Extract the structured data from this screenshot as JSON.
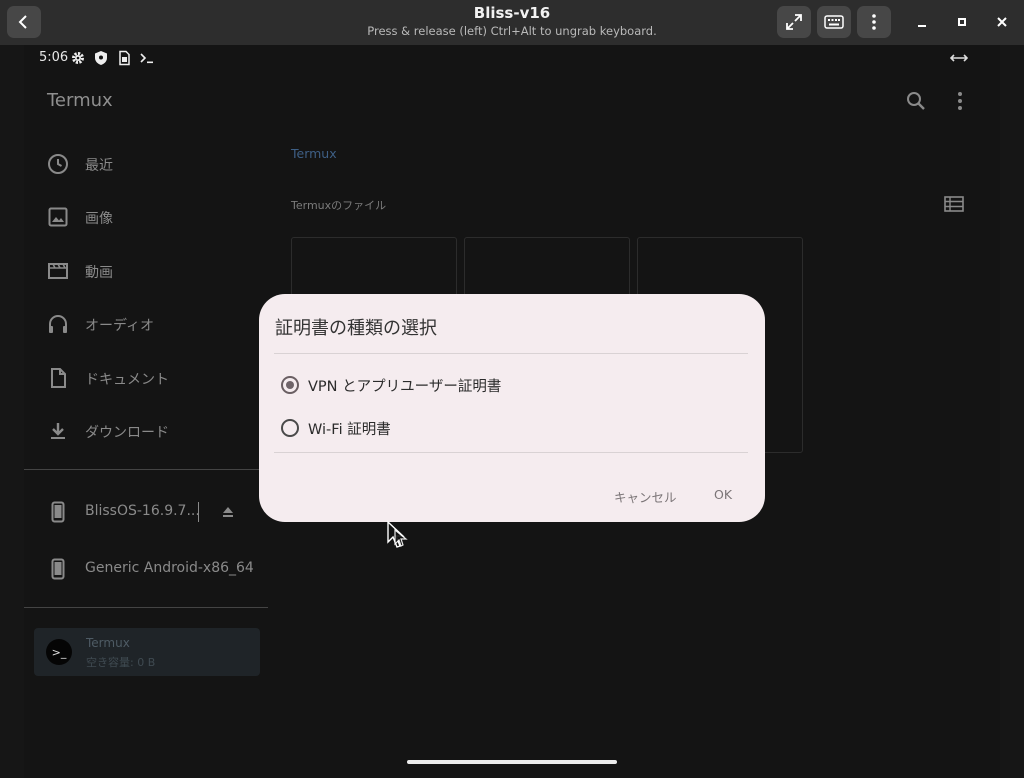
{
  "window": {
    "title": "Bliss-v16",
    "subtitle": "Press & release (left) Ctrl+Alt to ungrab keyboard."
  },
  "status_bar": {
    "time": "5:06",
    "icons": [
      "gear-icon",
      "shield-icon",
      "sim-card-icon",
      "terminal-icon"
    ],
    "right_icon": "resize-arrows-icon"
  },
  "app": {
    "title": "Termux",
    "actions": [
      "search-icon",
      "more-vert-icon"
    ]
  },
  "drawer": {
    "items": [
      {
        "label": "最近",
        "icon": "clock-icon"
      },
      {
        "label": "画像",
        "icon": "image-icon"
      },
      {
        "label": "動画",
        "icon": "movie-icon"
      },
      {
        "label": "オーディオ",
        "icon": "headphones-icon"
      },
      {
        "label": "ドキュメント",
        "icon": "document-icon"
      },
      {
        "label": "ダウンロード",
        "icon": "download-icon"
      }
    ],
    "devices": [
      {
        "label": "BlissOS-16.9.7...",
        "icon": "phone-icon",
        "action": "eject-icon"
      },
      {
        "label": "Generic Android-x86_64",
        "icon": "phone-icon"
      }
    ],
    "storage": {
      "name": "Termux",
      "free": "空き容量: 0 B"
    }
  },
  "main": {
    "breadcrumb": "Termux",
    "section_label": "Termuxのファイル",
    "view_icon": "list-view-icon"
  },
  "dialog": {
    "title": "証明書の種類の選択",
    "options": [
      {
        "label": "VPN とアプリユーザー証明書",
        "selected": true
      },
      {
        "label": "Wi-Fi 証明書",
        "selected": false
      }
    ],
    "cancel_label": "キャンセル",
    "ok_label": "OK"
  }
}
